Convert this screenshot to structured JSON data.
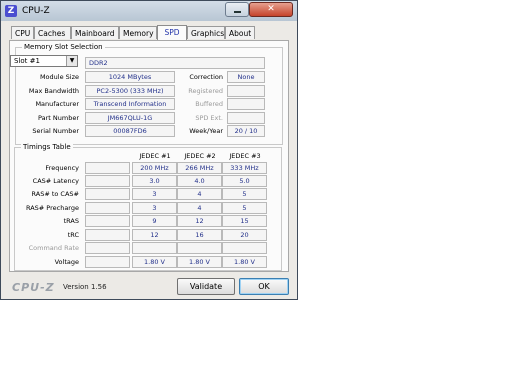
{
  "window": {
    "title": "CPU-Z",
    "icon_letter": "Z",
    "close_label": "✕"
  },
  "tabs": [
    {
      "label": "CPU"
    },
    {
      "label": "Caches"
    },
    {
      "label": "Mainboard"
    },
    {
      "label": "Memory"
    },
    {
      "label": "SPD",
      "active": true
    },
    {
      "label": "Graphics"
    },
    {
      "label": "About"
    }
  ],
  "memory_slot": {
    "group_title": "Memory Slot Selection",
    "slot_selected": "Slot #1",
    "type": "DDR2",
    "module_size_label": "Module Size",
    "module_size": "1024 MBytes",
    "max_bandwidth_label": "Max Bandwidth",
    "max_bandwidth": "PC2-5300 (333 MHz)",
    "manufacturer_label": "Manufacturer",
    "manufacturer": "Transcend Information",
    "part_number_label": "Part Number",
    "part_number": "JM667QLU-1G",
    "serial_number_label": "Serial Number",
    "serial_number": "00087FD6",
    "correction_label": "Correction",
    "correction": "None",
    "registered_label": "Registered",
    "registered": "",
    "buffered_label": "Buffered",
    "buffered": "",
    "spd_ext_label": "SPD Ext.",
    "spd_ext": "",
    "week_year_label": "Week/Year",
    "week_year": "20 / 10"
  },
  "timings": {
    "group_title": "Timings Table",
    "columns": [
      "JEDEC #1",
      "JEDEC #2",
      "JEDEC #3"
    ],
    "rows": [
      {
        "label": "Frequency",
        "values": [
          "200 MHz",
          "266 MHz",
          "333 MHz"
        ]
      },
      {
        "label": "CAS# Latency",
        "values": [
          "3.0",
          "4.0",
          "5.0"
        ]
      },
      {
        "label": "RAS# to CAS#",
        "values": [
          "3",
          "4",
          "5"
        ]
      },
      {
        "label": "RAS# Precharge",
        "values": [
          "3",
          "4",
          "5"
        ]
      },
      {
        "label": "tRAS",
        "values": [
          "9",
          "12",
          "15"
        ]
      },
      {
        "label": "tRC",
        "values": [
          "12",
          "16",
          "20"
        ]
      },
      {
        "label": "Command Rate",
        "values": [
          "",
          "",
          ""
        ],
        "dim": true
      },
      {
        "label": "Voltage",
        "values": [
          "1.80 V",
          "1.80 V",
          "1.80 V"
        ]
      }
    ]
  },
  "footer": {
    "logo": "CPU-Z",
    "version": "Version 1.56",
    "validate_label": "Validate",
    "ok_label": "OK"
  }
}
